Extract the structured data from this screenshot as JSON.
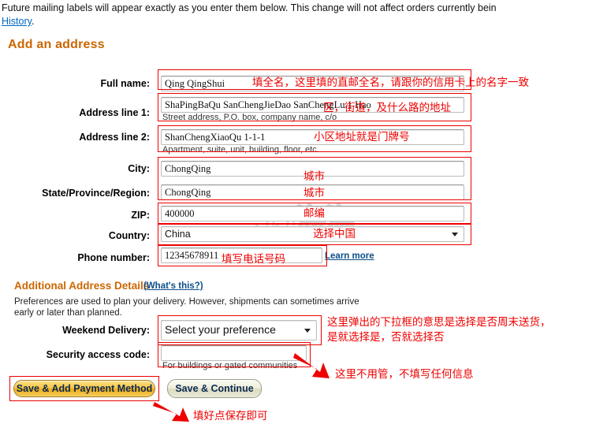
{
  "intro": {
    "text_before_link": "Future mailing labels will appear exactly as you enter them below. This change will not affect orders currently bein",
    "link_label": "History",
    "text_after_link": "."
  },
  "headings": {
    "add_address": "Add an address",
    "additional_details": "Additional Address Details",
    "whats_this": "(What's this?)",
    "preferences_note": "Preferences are used to plan your delivery. However, shipments can sometimes arrive early or later than planned."
  },
  "form": {
    "fields": [
      {
        "label": "Full name:",
        "value": "Qing QingShui",
        "hint": ""
      },
      {
        "label": "Address line 1:",
        "value": "ShaPingBaQu SanChengJieDao SanChengLu 1 Hao",
        "hint": "Street address, P.O. box, company name, c/o"
      },
      {
        "label": "Address line 2:",
        "value": "ShanChengXiaoQu 1-1-1",
        "hint": "Apartment, suite, unit, building, floor, etc."
      },
      {
        "label": "City:",
        "value": "ChongQing",
        "hint": ""
      },
      {
        "label": "State/Province/Region:",
        "value": "ChongQing",
        "hint": ""
      },
      {
        "label": "ZIP:",
        "value": "400000",
        "hint": ""
      },
      {
        "label": "Country:",
        "value": "China",
        "hint": ""
      },
      {
        "label": "Phone number:",
        "value": "12345678911",
        "hint": ""
      }
    ],
    "learn_more": "Learn more",
    "weekend_label": "Weekend Delivery:",
    "weekend_value": "Select your preference",
    "security_label": "Security access code:",
    "security_value": "",
    "security_hint": "For buildings or gated communities"
  },
  "buttons": {
    "save_add_payment": "Save & Add Payment Method",
    "save_continue": "Save & Continue"
  },
  "annotations": {
    "full_name": "填全名，这里填的直邮全名，请跟你的信用卡上的名字一致",
    "address1": "区，街道，及什么路的地址",
    "address2": "小区地址就是门牌号",
    "city": "城市",
    "state": "城市",
    "zip": "邮编",
    "country": "选择中国",
    "phone": "填写电话号码",
    "weekend_line1": "这里弹出的下拉框的意思是选择是否周末送货，",
    "weekend_line2": "是就选择是，否就选择否",
    "security": "这里不用管，不填写任何信息",
    "save": "填好点保存即可"
  },
  "watermark": {
    "text": "55海淘"
  },
  "colors": {
    "annotation_red": "#ee0000",
    "heading_orange": "#cc6600",
    "link_blue": "#0b4f8a"
  }
}
